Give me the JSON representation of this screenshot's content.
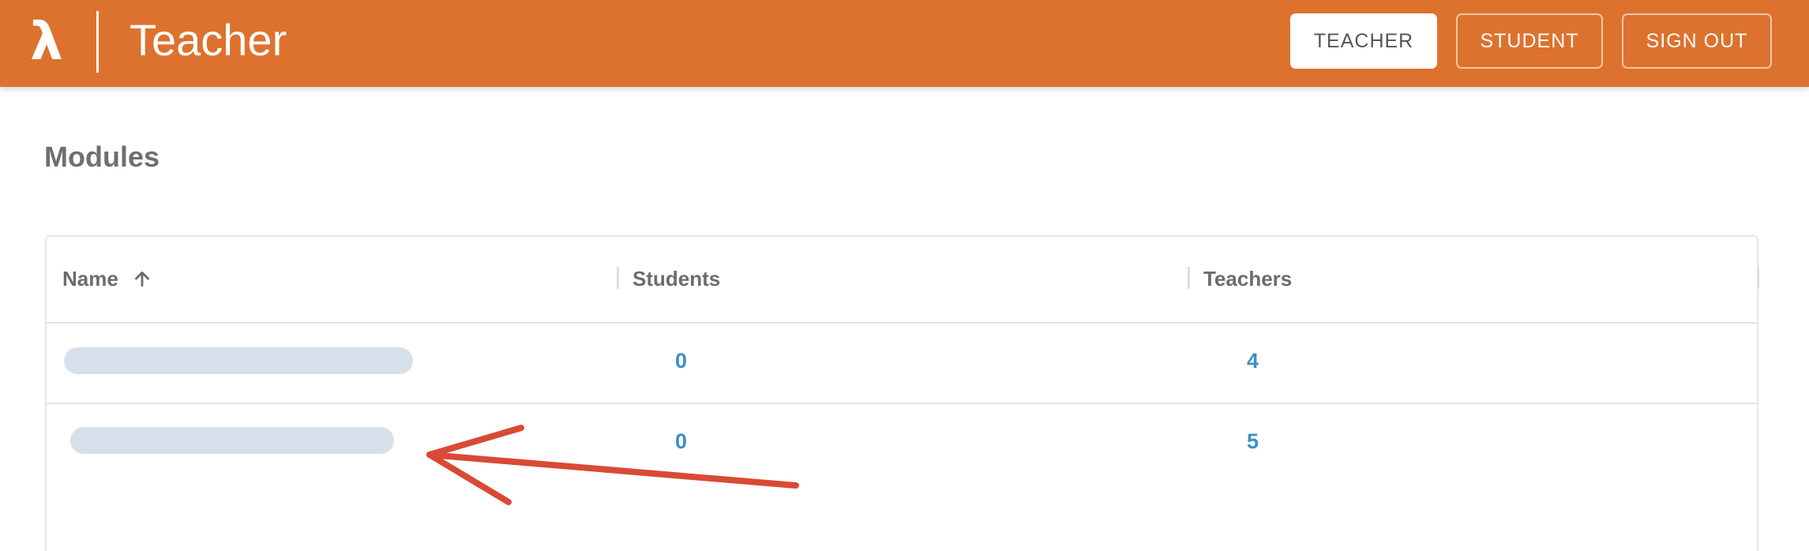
{
  "header": {
    "logo_icon": "lambda-icon",
    "logo_glyph": "λ",
    "title": "Teacher",
    "buttons": [
      {
        "label": "TEACHER",
        "active": true
      },
      {
        "label": "STUDENT",
        "active": false
      },
      {
        "label": "SIGN OUT",
        "active": false
      }
    ]
  },
  "page": {
    "heading": "Modules"
  },
  "table": {
    "columns": [
      {
        "label": "Name",
        "sort": "ascending",
        "sort_icon": "arrow-up-icon"
      },
      {
        "label": "Students"
      },
      {
        "label": "Teachers"
      }
    ],
    "rows": [
      {
        "name": "",
        "students": "0",
        "teachers": "4"
      },
      {
        "name": "",
        "students": "0",
        "teachers": "5"
      }
    ]
  },
  "colors": {
    "brand": "#DD722E",
    "link": "#3B8FC7",
    "redacted": "#D5E0EA",
    "annotation": "#D94A35"
  }
}
